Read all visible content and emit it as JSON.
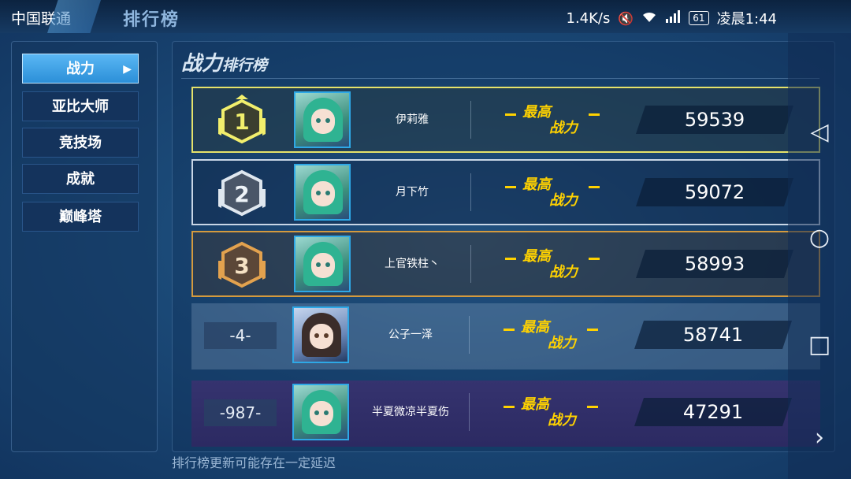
{
  "status_bar": {
    "carrier": "中国联通",
    "network_speed": "1.4K/s",
    "battery": "61",
    "time": "凌晨1:44",
    "icons": [
      "mute-icon",
      "wifi-icon",
      "signal-icon",
      "battery-icon"
    ]
  },
  "header": {
    "title": "排行榜"
  },
  "sidebar": {
    "items": [
      {
        "label": "战力",
        "active": true
      },
      {
        "label": "亚比大师"
      },
      {
        "label": "竞技场"
      },
      {
        "label": "成就"
      },
      {
        "label": "巅峰塔"
      }
    ],
    "active_arrow": "▶"
  },
  "panel": {
    "title_big": "战力",
    "title_small": "排行榜",
    "max_label_line1": "最高",
    "max_label_line2": "战力"
  },
  "rows": [
    {
      "rank": "1",
      "name": "伊莉雅",
      "score": "59539"
    },
    {
      "rank": "2",
      "name": "月下竹",
      "score": "59072"
    },
    {
      "rank": "3",
      "name": "上官铁柱丶",
      "score": "58993"
    },
    {
      "rank": "-4-",
      "name": "公子一泽",
      "score": "58741"
    }
  ],
  "my_row": {
    "rank": "-987-",
    "name": "半夏微凉半夏伤",
    "score": "47291"
  },
  "footer": {
    "note": "排行榜更新可能存在一定延迟"
  },
  "navbar": {
    "back": "◁",
    "home": "○",
    "recent": "□",
    "more": "›"
  },
  "colors": {
    "gold": "#e5e26a",
    "silver": "#c8d6e6",
    "bronze": "#d49a3e",
    "accent": "#ffd200",
    "active_tab": "#3fa3ea"
  }
}
